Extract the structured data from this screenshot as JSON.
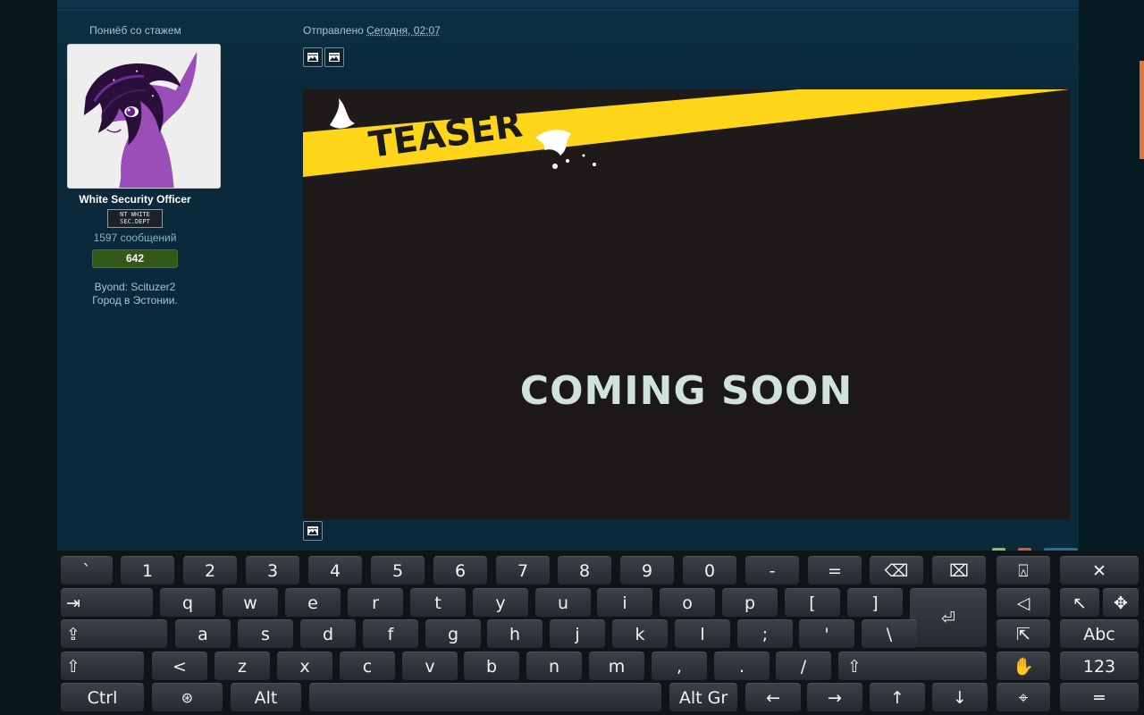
{
  "profile": {
    "user_title": "Пониёб со стажем",
    "rank": "White Security Officer",
    "rank_badge_line1": "NT WHITE",
    "rank_badge_line2": "SEC.DEPT",
    "post_count": "1597 сообщений",
    "reputation": "642",
    "byond": "Byond: Scituzer2",
    "city": "Город в Эстонии."
  },
  "post": {
    "posted_label": "Отправлено",
    "posted_date": "Сегодня, 02:07",
    "teaser_label": "TEASER",
    "coming_soon": "COMING SOON"
  },
  "colors": {
    "forum_bg": "#0a2a3b",
    "reputation_green": "#335716",
    "teaser_yellow": "#ffd51a",
    "tag_green": "#8bc34a",
    "tag_orange": "#e0582a",
    "tag_blue": "#1f6f9a"
  },
  "icons": {
    "post_tools": "image-icon",
    "keyboard_backspace": "backspace-icon",
    "keyboard_close": "close-icon"
  },
  "keyboard": {
    "row1": [
      "`",
      "1",
      "2",
      "3",
      "4",
      "5",
      "6",
      "7",
      "8",
      "9",
      "0",
      "-",
      "=",
      "⌫",
      "⌧"
    ],
    "row2": [
      "⇥",
      "q",
      "w",
      "e",
      "r",
      "t",
      "y",
      "u",
      "i",
      "o",
      "p",
      "[",
      "]"
    ],
    "row3": [
      "⇪",
      "a",
      "s",
      "d",
      "f",
      "g",
      "h",
      "j",
      "k",
      "l",
      ";",
      "'",
      "\\"
    ],
    "row4": [
      "⇧",
      "<",
      "z",
      "x",
      "c",
      "v",
      "b",
      "n",
      "m",
      ",",
      ".",
      "/",
      "⇧"
    ],
    "row5": [
      "Ctrl",
      "⊛",
      "Alt",
      "",
      "Alt Gr",
      "←",
      "→",
      "↑",
      "↓"
    ],
    "enter": "⏎",
    "side": {
      "r1a": "⍓",
      "r1b": "✕",
      "r2a": "◁",
      "r2b": "↖",
      "r2c": "✥",
      "r3a": "⇱",
      "r3b": "Abc",
      "r4a": "✋",
      "r4b": "123",
      "r5a": "⌖",
      "r5b": "═"
    }
  }
}
